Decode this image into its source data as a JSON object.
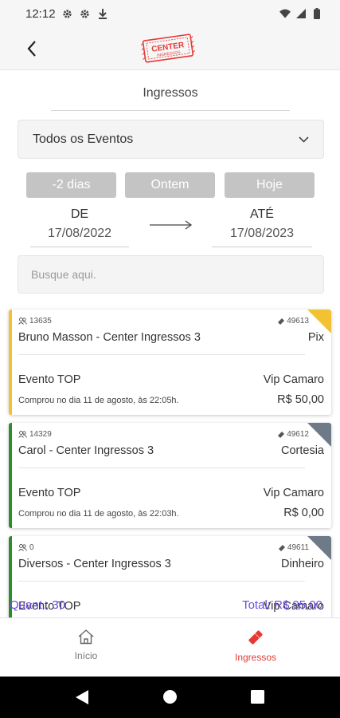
{
  "status_bar": {
    "time": "12:12"
  },
  "header": {
    "logo_text": "CENTER",
    "logo_subtext": "INGRESSOS"
  },
  "page": {
    "title": "Ingressos"
  },
  "filter": {
    "event_select": "Todos os Eventos",
    "quick_buttons": [
      "-2 dias",
      "Ontem",
      "Hoje"
    ],
    "from_label": "DE",
    "from_date": "17/08/2022",
    "to_label": "ATÉ",
    "to_date": "17/08/2023",
    "search_placeholder": "Busque aqui."
  },
  "sales": [
    {
      "user_id": "13635",
      "code": "49613",
      "name": "Bruno Masson - Center Ingressos 3",
      "payment": "Pix",
      "event": "Evento TOP",
      "sector": "Vip Camaro",
      "date_text": "Comprou no dia 11 de agosto, às 22:05h.",
      "price": "R$ 50,00",
      "status_color": "#f1c232"
    },
    {
      "user_id": "14329",
      "code": "49612",
      "name": "Carol - Center Ingressos 3",
      "payment": "Cortesia",
      "event": "Evento TOP",
      "sector": "Vip Camaro",
      "date_text": "Comprou no dia 11 de agosto, às 22:03h.",
      "price": "R$ 0,00",
      "status_color": "#2e8b2e"
    },
    {
      "user_id": "0",
      "code": "49611",
      "name": "Diversos - Center Ingressos 3",
      "payment": "Dinheiro",
      "event": "Evento TOP",
      "sector": "Vip Camaro",
      "date_text": "",
      "price": "",
      "status_color": "#2e8b2e"
    }
  ],
  "totals": {
    "quantity": "Quant.: 30",
    "total": "Total: R$ 95,00"
  },
  "bottom_nav": {
    "home_label": "Início",
    "tickets_label": "Ingressos"
  },
  "colors": {
    "accent": "#e53935",
    "totals_text": "#6b4ce0",
    "pending": "#f1c232",
    "confirmed": "#2e8b2e"
  }
}
